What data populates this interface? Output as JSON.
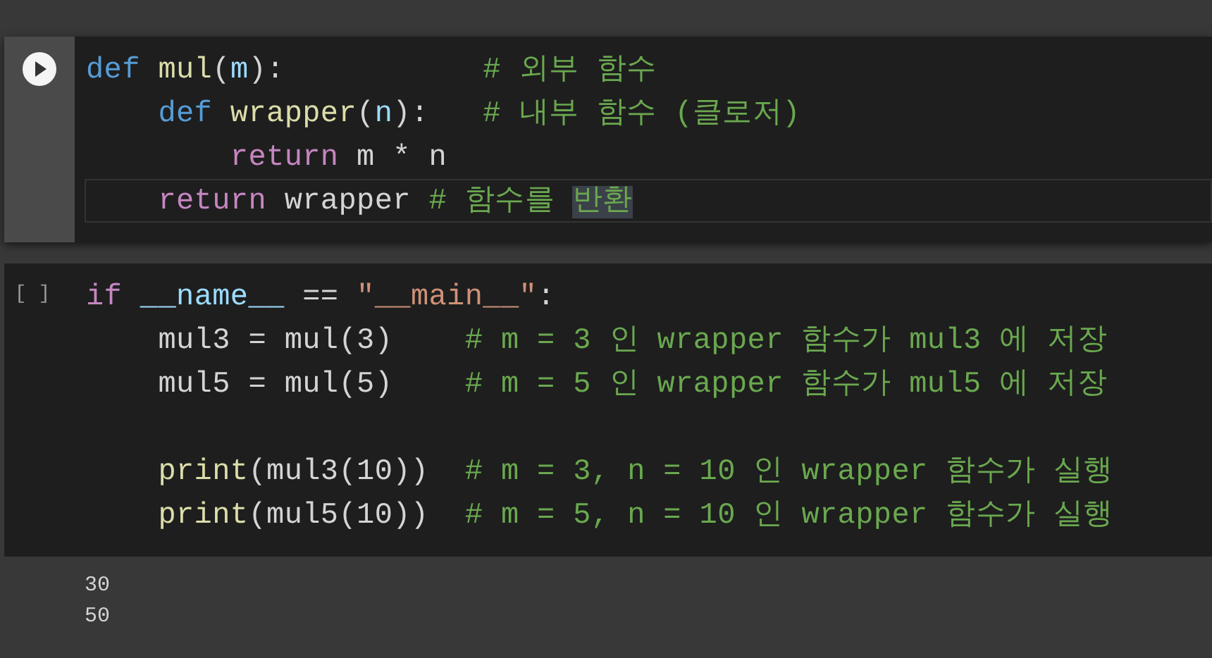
{
  "cells": [
    {
      "kind": "run",
      "focused": true,
      "lines": [
        {
          "active": false,
          "tokens": [
            {
              "t": "def",
              "kind": "keyword"
            },
            {
              "t": " mul",
              "kind": "function"
            },
            {
              "t": "(",
              "kind": "plain"
            },
            {
              "t": "m",
              "kind": "param"
            },
            {
              "t": "):",
              "kind": "plain"
            },
            {
              "t": "           # 외부 함수",
              "kind": "comment"
            }
          ]
        },
        {
          "active": false,
          "tokens": [
            {
              "t": "    def",
              "kind": "keyword"
            },
            {
              "t": " wrapper",
              "kind": "function"
            },
            {
              "t": "(",
              "kind": "plain"
            },
            {
              "t": "n",
              "kind": "param"
            },
            {
              "t": "):",
              "kind": "plain"
            },
            {
              "t": "   # 내부 함수 (클로저)",
              "kind": "comment"
            }
          ]
        },
        {
          "active": false,
          "tokens": [
            {
              "t": "        return",
              "kind": "control"
            },
            {
              "t": " m * n",
              "kind": "plain"
            }
          ]
        },
        {
          "active": true,
          "tokens": [
            {
              "t": "    return",
              "kind": "control",
              "highlighted": false
            },
            {
              "t": " wrapper",
              "kind": "plain",
              "highlighted": false
            },
            {
              "t": " # 함수를 ",
              "kind": "comment",
              "highlighted": false
            },
            {
              "t": "반환",
              "kind": "comment",
              "highlighted": true
            }
          ]
        }
      ]
    },
    {
      "kind": "prompt",
      "focused": false,
      "prompt": "[ ]",
      "lines": [
        {
          "active": false,
          "tokens": [
            {
              "t": "if",
              "kind": "control"
            },
            {
              "t": " __name__",
              "kind": "param"
            },
            {
              "t": " ==",
              "kind": "plain"
            },
            {
              "t": " \"__main__\"",
              "kind": "string"
            },
            {
              "t": ":",
              "kind": "plain"
            }
          ]
        },
        {
          "active": false,
          "tokens": [
            {
              "t": "    mul3 = mul(3)",
              "kind": "plain"
            },
            {
              "t": "    # m = 3 인 wrapper 함수가 mul3 에 저장",
              "kind": "comment"
            }
          ]
        },
        {
          "active": false,
          "tokens": [
            {
              "t": "    mul5 = mul(5)",
              "kind": "plain"
            },
            {
              "t": "    # m = 5 인 wrapper 함수가 mul5 에 저장",
              "kind": "comment"
            }
          ]
        },
        {
          "kind": "blank"
        },
        {
          "active": false,
          "tokens": [
            {
              "t": "    print",
              "kind": "function"
            },
            {
              "t": "(mul3(10))",
              "kind": "plain"
            },
            {
              "t": "  # m = 3, n = 10 인 wrapper 함수가 실행",
              "kind": "comment"
            }
          ]
        },
        {
          "active": false,
          "tokens": [
            {
              "t": "    print",
              "kind": "function"
            },
            {
              "t": "(mul5(10))",
              "kind": "plain"
            },
            {
              "t": "  # m = 5, n = 10 인 wrapper 함수가 실행",
              "kind": "comment"
            }
          ]
        }
      ],
      "output": [
        "30",
        "50"
      ]
    }
  ]
}
